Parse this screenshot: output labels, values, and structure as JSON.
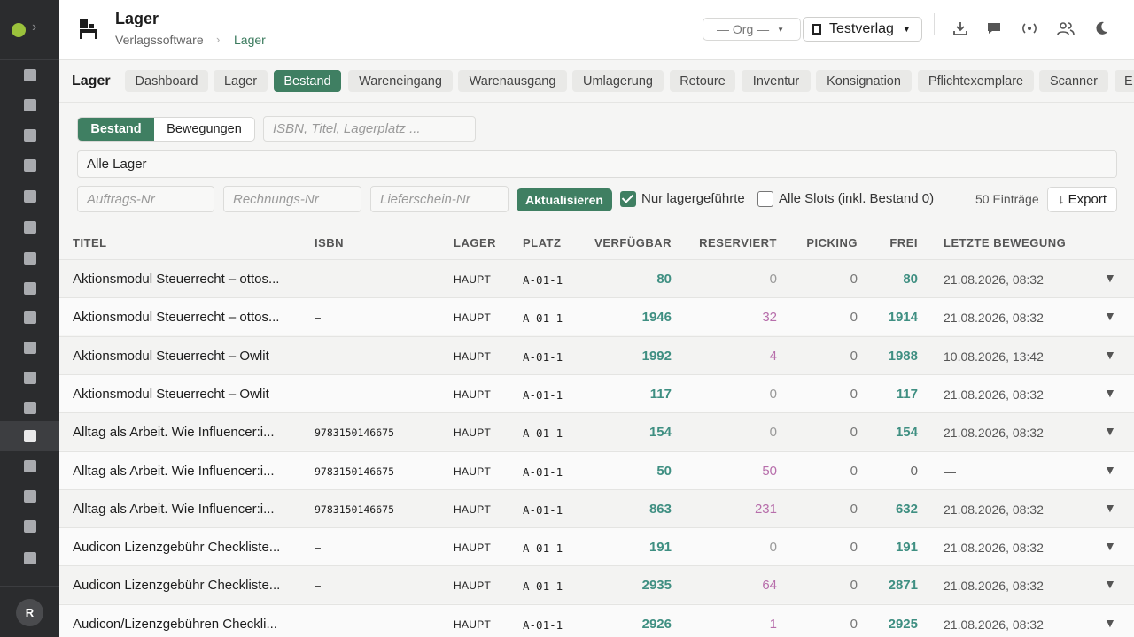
{
  "header": {
    "title": "Lager",
    "breadcrumb": [
      "Verlagssoftware",
      "Lager"
    ],
    "breadcrumb_sep": "›",
    "org_select": "— Org —",
    "verlag_select": "Testverlag",
    "action_icons": [
      "download-icon",
      "chat-icon",
      "broadcast-icon",
      "users-icon",
      "moon-icon"
    ]
  },
  "sidebar": {
    "avatar": "R",
    "items": [
      "image-icon",
      "briefcase-icon",
      "dashboard-icon",
      "receipt-icon",
      "feather-icon",
      "truck-icon",
      "sync-icon",
      "bag-icon",
      "megaphone-icon",
      "video-icon",
      "music-icon",
      "document-icon",
      "warehouse-icon",
      "export-icon",
      "chart-icon",
      "calculator-icon",
      "shield-icon"
    ],
    "active": "warehouse-icon"
  },
  "tabs": {
    "title": "Lager",
    "items": [
      "Dashboard",
      "Lager",
      "Bestand",
      "Wareneingang",
      "Warenausgang",
      "Umlagerung",
      "Retoure",
      "Inventur",
      "Konsignation",
      "Pflichtexemplare",
      "Scanner",
      "E"
    ],
    "active": "Bestand"
  },
  "filters": {
    "segment_active": "Bestand",
    "segment_other": "Bewegungen",
    "search_placeholder": "ISBN, Titel, Lagerplatz ...",
    "lager_select": "Alle Lager",
    "auftrag_placeholder": "Auftrags-Nr",
    "rechnung_placeholder": "Rechnungs-Nr",
    "lieferschein_placeholder": "Lieferschein-Nr",
    "refresh_label": "Aktualisieren",
    "cb1_label": "Nur lagergeführte",
    "cb1_checked": true,
    "cb2_label": "Alle Slots (inkl. Bestand 0)",
    "cb2_checked": false,
    "count": "50 Einträge",
    "export_label": "↓ Export"
  },
  "table": {
    "columns": [
      "TITEL",
      "ISBN",
      "LAGER",
      "PLATZ",
      "VERFÜGBAR",
      "RESERVIERT",
      "PICKING",
      "FREI",
      "LETZTE BEWEGUNG"
    ],
    "rows": [
      {
        "title": "Aktionsmodul Steuerrecht – ottos...",
        "isbn": "–",
        "lager": "HAUPT",
        "platz": "A-01-1",
        "verfuegbar": "80",
        "reserviert": "0",
        "picking": "0",
        "frei": "80",
        "letzte": "21.08.2026, 08:32"
      },
      {
        "title": "Aktionsmodul Steuerrecht – ottos...",
        "isbn": "–",
        "lager": "HAUPT",
        "platz": "A-01-1",
        "verfuegbar": "1946",
        "reserviert": "32",
        "picking": "0",
        "frei": "1914",
        "letzte": "21.08.2026, 08:32"
      },
      {
        "title": "Aktionsmodul Steuerrecht – Owlit",
        "isbn": "–",
        "lager": "HAUPT",
        "platz": "A-01-1",
        "verfuegbar": "1992",
        "reserviert": "4",
        "picking": "0",
        "frei": "1988",
        "letzte": "10.08.2026, 13:42"
      },
      {
        "title": "Aktionsmodul Steuerrecht – Owlit",
        "isbn": "–",
        "lager": "HAUPT",
        "platz": "A-01-1",
        "verfuegbar": "117",
        "reserviert": "0",
        "picking": "0",
        "frei": "117",
        "letzte": "21.08.2026, 08:32"
      },
      {
        "title": "Alltag als Arbeit. Wie Influencer:i...",
        "isbn": "9783150146675",
        "lager": "HAUPT",
        "platz": "A-01-1",
        "verfuegbar": "154",
        "reserviert": "0",
        "picking": "0",
        "frei": "154",
        "letzte": "21.08.2026, 08:32"
      },
      {
        "title": "Alltag als Arbeit. Wie Influencer:i...",
        "isbn": "9783150146675",
        "lager": "HAUPT",
        "platz": "A-01-1",
        "verfuegbar": "50",
        "reserviert": "50",
        "picking": "0",
        "frei": "0",
        "letzte": "—"
      },
      {
        "title": "Alltag als Arbeit. Wie Influencer:i...",
        "isbn": "9783150146675",
        "lager": "HAUPT",
        "platz": "A-01-1",
        "verfuegbar": "863",
        "reserviert": "231",
        "picking": "0",
        "frei": "632",
        "letzte": "21.08.2026, 08:32"
      },
      {
        "title": "Audicon Lizenzgebühr Checkliste...",
        "isbn": "–",
        "lager": "HAUPT",
        "platz": "A-01-1",
        "verfuegbar": "191",
        "reserviert": "0",
        "picking": "0",
        "frei": "191",
        "letzte": "21.08.2026, 08:32"
      },
      {
        "title": "Audicon Lizenzgebühr Checkliste...",
        "isbn": "–",
        "lager": "HAUPT",
        "platz": "A-01-1",
        "verfuegbar": "2935",
        "reserviert": "64",
        "picking": "0",
        "frei": "2871",
        "letzte": "21.08.2026, 08:32"
      },
      {
        "title": "Audicon/Lizenzgebühren Checkli...",
        "isbn": "–",
        "lager": "HAUPT",
        "platz": "A-01-1",
        "verfuegbar": "2926",
        "reserviert": "1",
        "picking": "0",
        "frei": "2925",
        "letzte": "21.08.2026, 08:32"
      }
    ],
    "expand_glyph": "▼"
  }
}
